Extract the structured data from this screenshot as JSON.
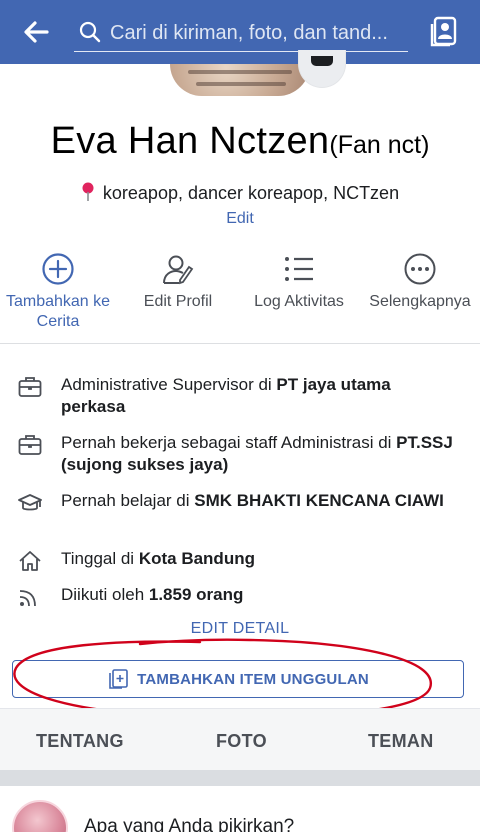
{
  "colors": {
    "brand": "#4267b2",
    "text": "#1c1e21",
    "annotation": "#d0021b"
  },
  "topbar": {
    "back_icon": "arrow-left-icon",
    "search_icon": "search-icon",
    "search_placeholder": "Cari di kiriman, foto, dan tand...",
    "profile_switch_icon": "profile-switch-icon"
  },
  "profile": {
    "name": "Eva Han Nctzen",
    "alternate_name": "(Fan nct)",
    "bio_icon": "map-pin-icon",
    "bio": "koreapop, dancer koreapop, NCTzen",
    "edit_bio_label": "Edit"
  },
  "actions": [
    {
      "icon": "add-story-icon",
      "label_line1": "Tambahkan ke",
      "label_line2": "Cerita"
    },
    {
      "icon": "edit-profile-icon",
      "label": "Edit Profil"
    },
    {
      "icon": "activity-log-icon",
      "label": "Log Aktivitas"
    },
    {
      "icon": "more-icon",
      "label": "Selengkapnya"
    }
  ],
  "details": [
    {
      "icon": "briefcase-icon",
      "prefix": "Administrative Supervisor di ",
      "bold": "PT jaya utama perkasa"
    },
    {
      "icon": "briefcase-icon",
      "prefix": "Pernah bekerja sebagai  staff Administrasi di ",
      "bold": "PT.SSJ (sujong sukses jaya)"
    },
    {
      "icon": "graduation-cap-icon",
      "prefix": "Pernah belajar di ",
      "bold": "SMK BHAKTI KENCANA CIAWI"
    },
    {
      "icon": "home-icon",
      "prefix": "Tinggal di ",
      "bold": "Kota Bandung"
    },
    {
      "icon": "followers-icon",
      "prefix": "Diikuti oleh ",
      "bold": "1.859 orang"
    }
  ],
  "edit_detail_label": "EDIT DETAIL",
  "featured_button": {
    "icon": "add-featured-icon",
    "label": "TAMBAHKAN ITEM UNGGULAN"
  },
  "tabs": [
    "TENTANG",
    "FOTO",
    "TEMAN"
  ],
  "composer": {
    "prompt": "Apa yang Anda pikirkan?"
  }
}
